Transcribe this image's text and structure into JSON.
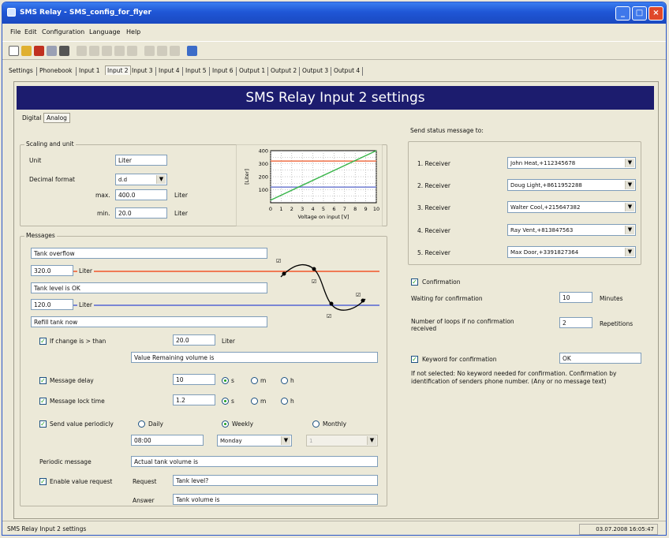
{
  "window": {
    "title": "SMS Relay - SMS_config_for_flyer"
  },
  "menu": [
    "File",
    "Edit",
    "Configuration",
    "Language",
    "Help"
  ],
  "tabs": [
    "Settings",
    "Phonebook",
    "Input 1",
    "Input 2",
    "Input 3",
    "Input 4",
    "Input 5",
    "Input 6",
    "Output 1",
    "Output 2",
    "Output 3",
    "Output 4"
  ],
  "banner": "SMS Relay Input 2 settings",
  "subtabs": [
    "Digital",
    "Analog"
  ],
  "scaling": {
    "title": "Scaling and unit",
    "unit_label": "Unit",
    "unit_value": "Liter",
    "decimal_label": "Decimal format",
    "decimal_value": "d.d",
    "max_label": "max.",
    "max_value": "400.0",
    "max_unit": "Liter",
    "min_label": "min.",
    "min_value": "20.0",
    "min_unit": "Liter"
  },
  "mini_chart": {
    "y_ticks": [
      "400",
      "300",
      "200",
      "100"
    ],
    "x_ticks": [
      "0",
      "1",
      "2",
      "3",
      "4",
      "5",
      "6",
      "7",
      "8",
      "9",
      "10"
    ],
    "y_label": "[Liter]",
    "x_label": "Voltage on input [V]"
  },
  "chart_data": {
    "type": "line",
    "x": [
      0,
      10
    ],
    "series": [
      {
        "values": [
          20,
          400
        ]
      }
    ],
    "ref_lines": [
      320,
      120
    ],
    "xlim": [
      0,
      10
    ],
    "ylim": [
      0,
      400
    ],
    "xlabel": "Voltage on input [V]",
    "ylabel": "[Liter]"
  },
  "messages": {
    "title": "Messages",
    "msg_over": "Tank overflow",
    "level_high": "320.0",
    "level_high_unit": "Liter",
    "msg_ok": "Tank level is OK",
    "level_low": "120.0",
    "level_low_unit": "Liter",
    "msg_refill": "Refill tank now",
    "change_label": "If change is > than",
    "change_value": "20.0",
    "change_unit": "Liter",
    "value_text": "Value Remaining volume is",
    "delay_label": "Message delay",
    "delay_value": "10",
    "lock_label": "Message lock time",
    "lock_value": "1.2",
    "unit_s": "s",
    "unit_m": "m",
    "unit_h": "h",
    "periodic_label": "Send value periodicly",
    "daily": "Daily",
    "weekly": "Weekly",
    "monthly": "Monthly",
    "time_value": "08:00",
    "day_value": "Monday",
    "month_value": "1",
    "periodic_msg_label": "Periodic message",
    "periodic_msg_value": "Actual tank volume is",
    "enable_request_label": "Enable value request",
    "request_label": "Request",
    "request_value": "Tank level?",
    "answer_label": "Answer",
    "answer_value": "Tank volume is"
  },
  "status_send": {
    "title": "Send status message to:",
    "receivers": [
      {
        "label": "1. Receiver",
        "value": "John Heat,+112345678"
      },
      {
        "label": "2. Receiver",
        "value": "Doug Light,+8611952288"
      },
      {
        "label": "3. Receiver",
        "value": "Walter Cool,+215647382"
      },
      {
        "label": "4. Receiver",
        "value": "Ray Vent,+813847563"
      },
      {
        "label": "5. Receiver",
        "value": "Max Door,+3391827364"
      }
    ]
  },
  "confirmation": {
    "label": "Confirmation",
    "waiting_label": "Waiting for confirmation",
    "waiting_value": "10",
    "waiting_unit": "Minutes",
    "loops_label": "Number of loops if no confirmation received",
    "loops_value": "2",
    "loops_unit": "Repetitions",
    "keyword_label": "Keyword for confirmation",
    "keyword_value": "OK",
    "note": "If not selected: No keyword needed for confirmation. Confirmation by identification of senders phone number. (Any or no message text)"
  },
  "statusbar": {
    "left": "SMS Relay Input 2 settings",
    "right": "03.07.2008 16:05:47"
  },
  "colors": {
    "banner_bg": "#1c1c6e",
    "high_line": "#f07a55",
    "low_line": "#7a86d4",
    "series_line": "#39b54a"
  }
}
